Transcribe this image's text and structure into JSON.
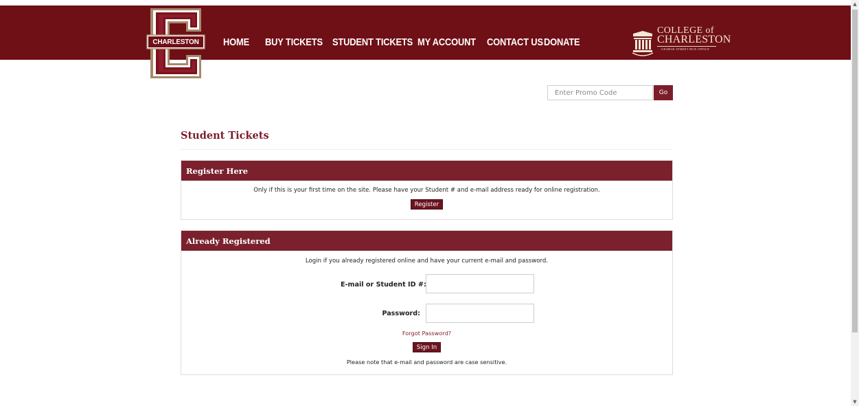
{
  "brand": {
    "logo_text": "CHARLESTON",
    "cofc_line1": "COLLEGE of",
    "cofc_line2": "CHARLESTON",
    "cofc_sub": "GEORGE STREET BOX OFFICE",
    "colors": {
      "navbar": "#6f0f16",
      "accent": "#7c1d2a",
      "panel_header": "#7a212d"
    }
  },
  "nav": {
    "home": "HOME",
    "buy_tickets": "BUY TICKETS",
    "student_tickets": "STUDENT TICKETS",
    "my_account": "MY ACCOUNT",
    "contact_us": "CONTACT US",
    "donate": "DONATE"
  },
  "promo": {
    "placeholder": "Enter Promo Code",
    "value": "",
    "go_label": "Go"
  },
  "page": {
    "title": "Student Tickets"
  },
  "register_panel": {
    "heading": "Register Here",
    "text": "Only if this is your first time on the site. Please have your Student # and e-mail address ready for online registration.",
    "button": "Register"
  },
  "login_panel": {
    "heading": "Already Registered",
    "intro": "Login if you already registered online and have your current e-mail and password.",
    "email_label": "E-mail or Student ID #:",
    "email_value": "",
    "password_label": "Password:",
    "password_value": "",
    "forgot_link": "Forgot Password?",
    "signin_button": "Sign In",
    "note": "Please note that e-mail and password are case sensitive."
  },
  "icons": {
    "scroll_up": "triangle-up",
    "scroll_down": "triangle-down"
  }
}
